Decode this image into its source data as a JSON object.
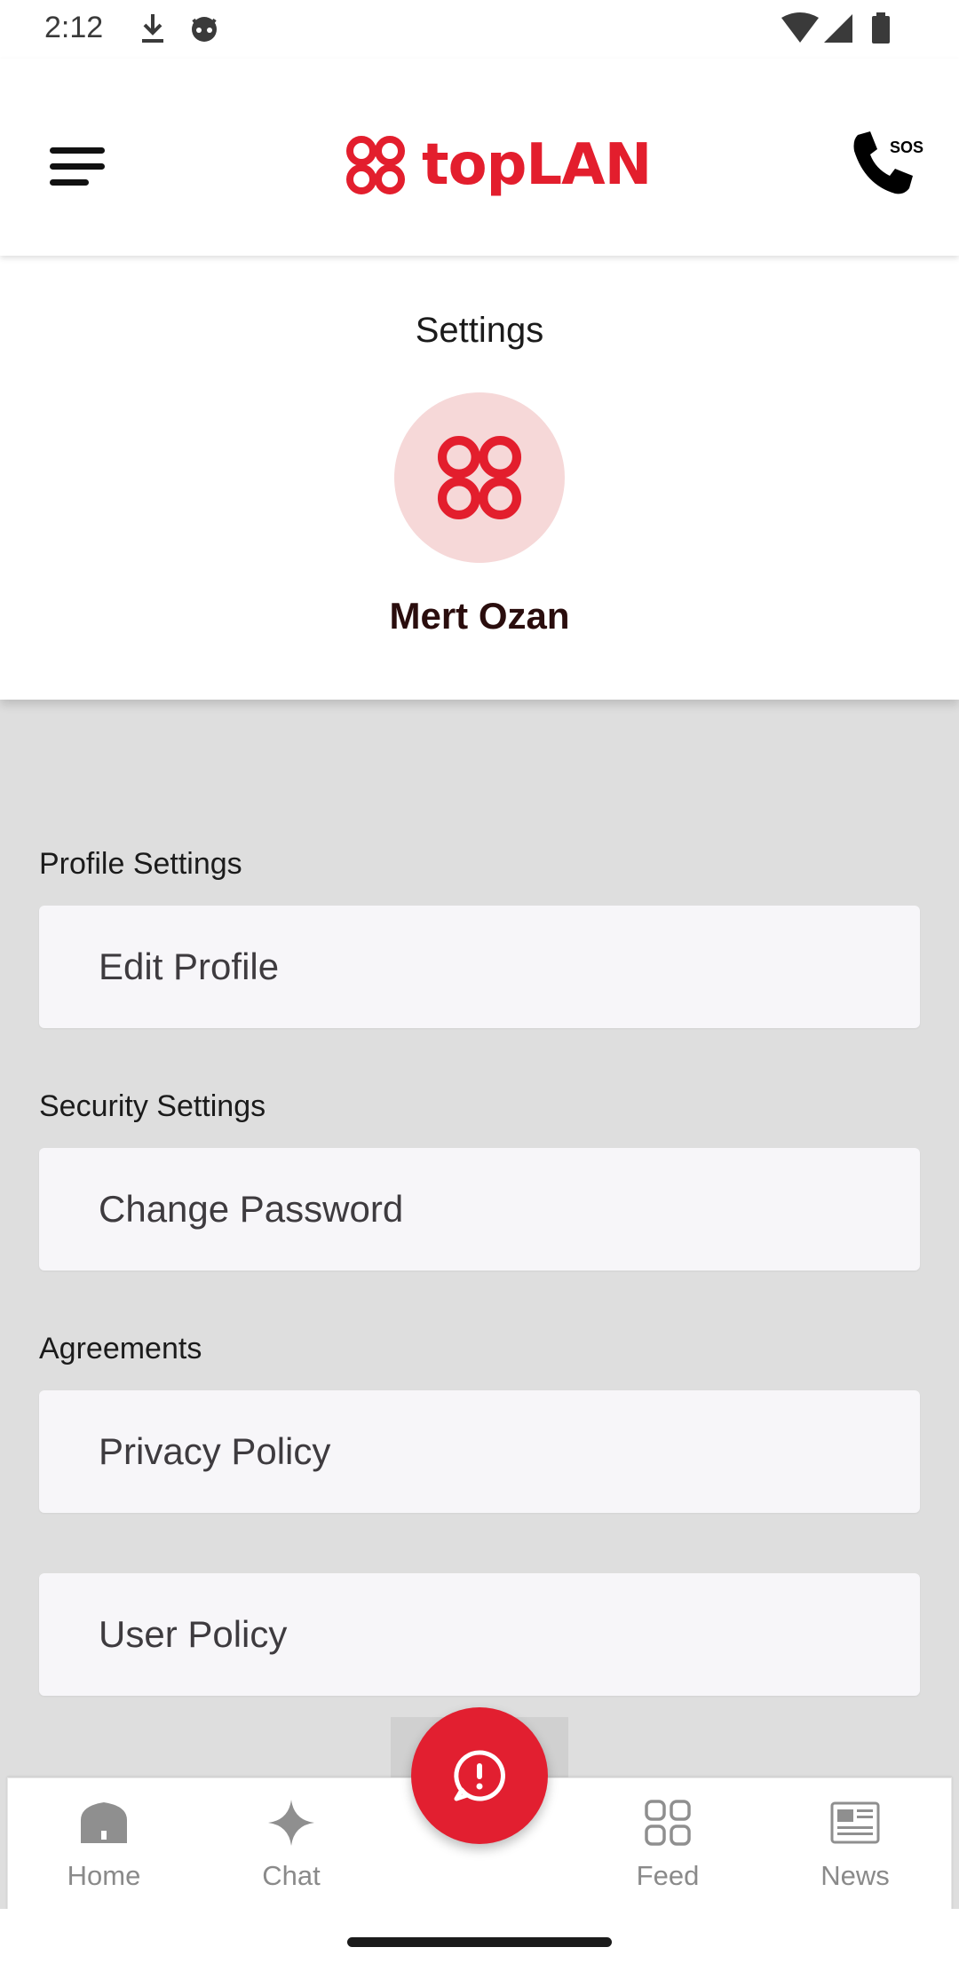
{
  "status_bar": {
    "time": "2:12",
    "icons": [
      "download-icon",
      "cat-face-icon",
      "wifi-icon",
      "cellular-signal-icon",
      "battery-icon"
    ]
  },
  "header": {
    "menu_icon": "menu-icon",
    "logo_text": "topLAN",
    "sos_icon": "phone-sos-icon",
    "sos_label": "SOS",
    "brand_color": "#e31e2d"
  },
  "profile": {
    "title": "Settings",
    "name": "Mert Ozan",
    "avatar_icon": "toplan-logo-icon",
    "avatar_bg": "#f6d8d8"
  },
  "sections": [
    {
      "label": "Profile Settings",
      "items": [
        {
          "label": "Edit Profile"
        }
      ]
    },
    {
      "label": "Security Settings",
      "items": [
        {
          "label": "Change Password"
        }
      ]
    },
    {
      "label": "Agreements",
      "items": [
        {
          "label": "Privacy Policy"
        },
        {
          "label": "User Policy"
        }
      ]
    }
  ],
  "bottom_nav": {
    "items": [
      {
        "label": "Home",
        "icon": "home-icon"
      },
      {
        "label": "Chat",
        "icon": "sparkle-icon"
      },
      {
        "label": "Feed",
        "icon": "feed-grid-icon"
      },
      {
        "label": "News",
        "icon": "newspaper-icon"
      }
    ],
    "fab_icon": "alert-chat-icon",
    "fab_color": "#e21f30"
  }
}
